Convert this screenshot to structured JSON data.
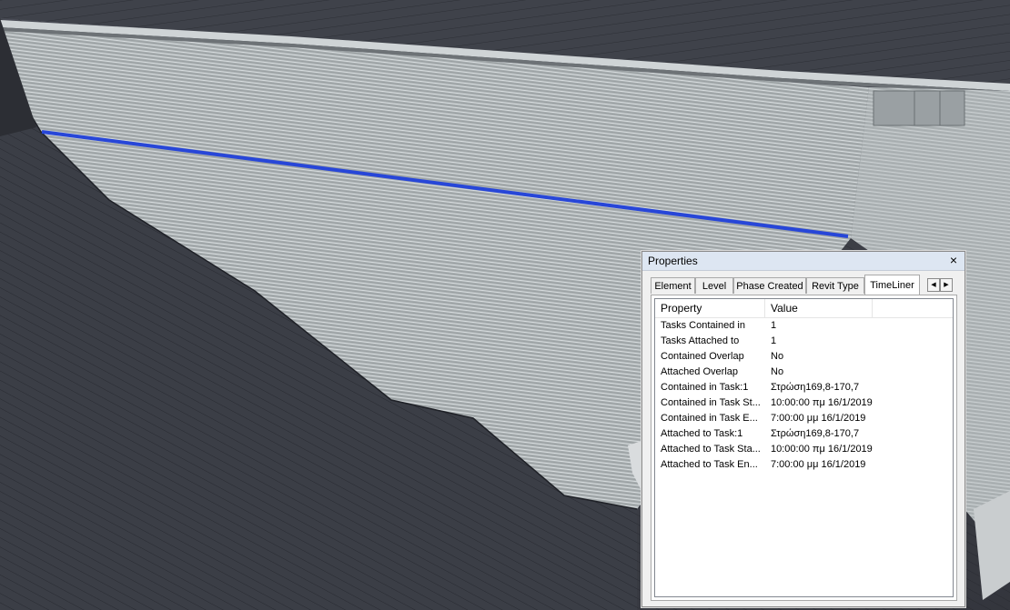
{
  "panel": {
    "title": "Properties",
    "close_glyph": "×"
  },
  "tabs": [
    {
      "label": "Element",
      "active": false
    },
    {
      "label": "Level",
      "active": false
    },
    {
      "label": "Phase Created",
      "active": false
    },
    {
      "label": "Revit Type",
      "active": false
    },
    {
      "label": "TimeLiner",
      "active": true
    }
  ],
  "tab_scroll": {
    "left_glyph": "◀",
    "right_glyph": "▶"
  },
  "columns": [
    "Property",
    "Value"
  ],
  "rows": [
    {
      "property": "Tasks Contained in",
      "value": "1"
    },
    {
      "property": "Tasks Attached to",
      "value": "1"
    },
    {
      "property": "Contained Overlap",
      "value": "No"
    },
    {
      "property": "Attached Overlap",
      "value": "No"
    },
    {
      "property": "Contained in Task:1",
      "value": "Στρώση169,8-170,7"
    },
    {
      "property": "Contained in Task St...",
      "value": "10:00:00 πμ 16/1/2019"
    },
    {
      "property": "Contained in Task E...",
      "value": "7:00:00 μμ 16/1/2019"
    },
    {
      "property": "Attached to Task:1",
      "value": "Στρώση169,8-170,7"
    },
    {
      "property": "Attached to Task Sta...",
      "value": "10:00:00 πμ 16/1/2019"
    },
    {
      "property": "Attached to Task En...",
      "value": "7:00:00 μμ 16/1/2019"
    }
  ],
  "colors": {
    "selection_line": "#2746d8",
    "dam_face": "#a8aeb0",
    "terrain": "#41444d"
  }
}
